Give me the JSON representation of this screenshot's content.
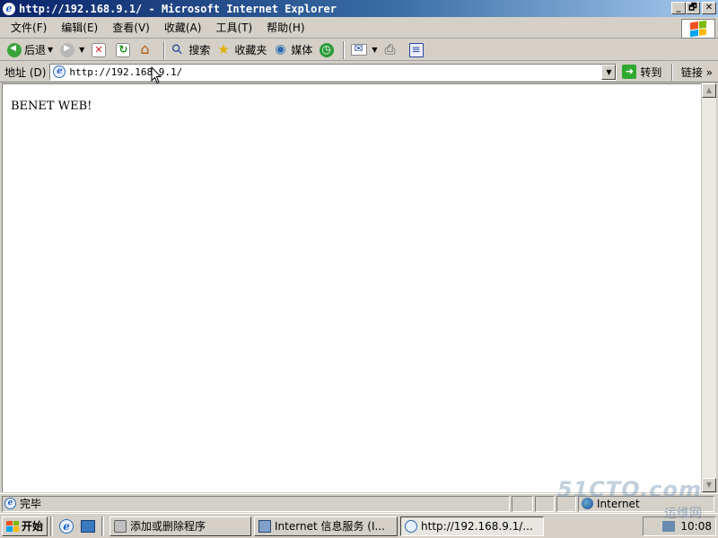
{
  "window": {
    "title": "http://192.168.9.1/ - Microsoft Internet Explorer",
    "controls": {
      "minimize": "_",
      "maximize": "🗗",
      "close": "✕"
    }
  },
  "menubar": {
    "items": [
      {
        "label": "文件",
        "key": "(F)"
      },
      {
        "label": "编辑",
        "key": "(E)"
      },
      {
        "label": "查看",
        "key": "(V)"
      },
      {
        "label": "收藏",
        "key": "(A)"
      },
      {
        "label": "工具",
        "key": "(T)"
      },
      {
        "label": "帮助",
        "key": "(H)"
      }
    ]
  },
  "toolbar": {
    "back": "后退",
    "search": "搜索",
    "favorites": "收藏夹",
    "media": "媒体"
  },
  "addressbar": {
    "label": "地址 (D)",
    "url": "http://192.168.9.1/",
    "go": "转到",
    "links": "链接",
    "links_chevron": "»"
  },
  "page": {
    "text": "BENET WEB!"
  },
  "statusbar": {
    "status": "完毕",
    "zone": "Internet"
  },
  "taskbar": {
    "start": "开始",
    "tasks": [
      {
        "label": "添加或删除程序"
      },
      {
        "label": "Internet 信息服务 (I..."
      },
      {
        "label": "http://192.168.9.1/..."
      }
    ],
    "clock": "10:08"
  },
  "watermark": {
    "main": "51CTO.com",
    "sub": "运维网"
  }
}
